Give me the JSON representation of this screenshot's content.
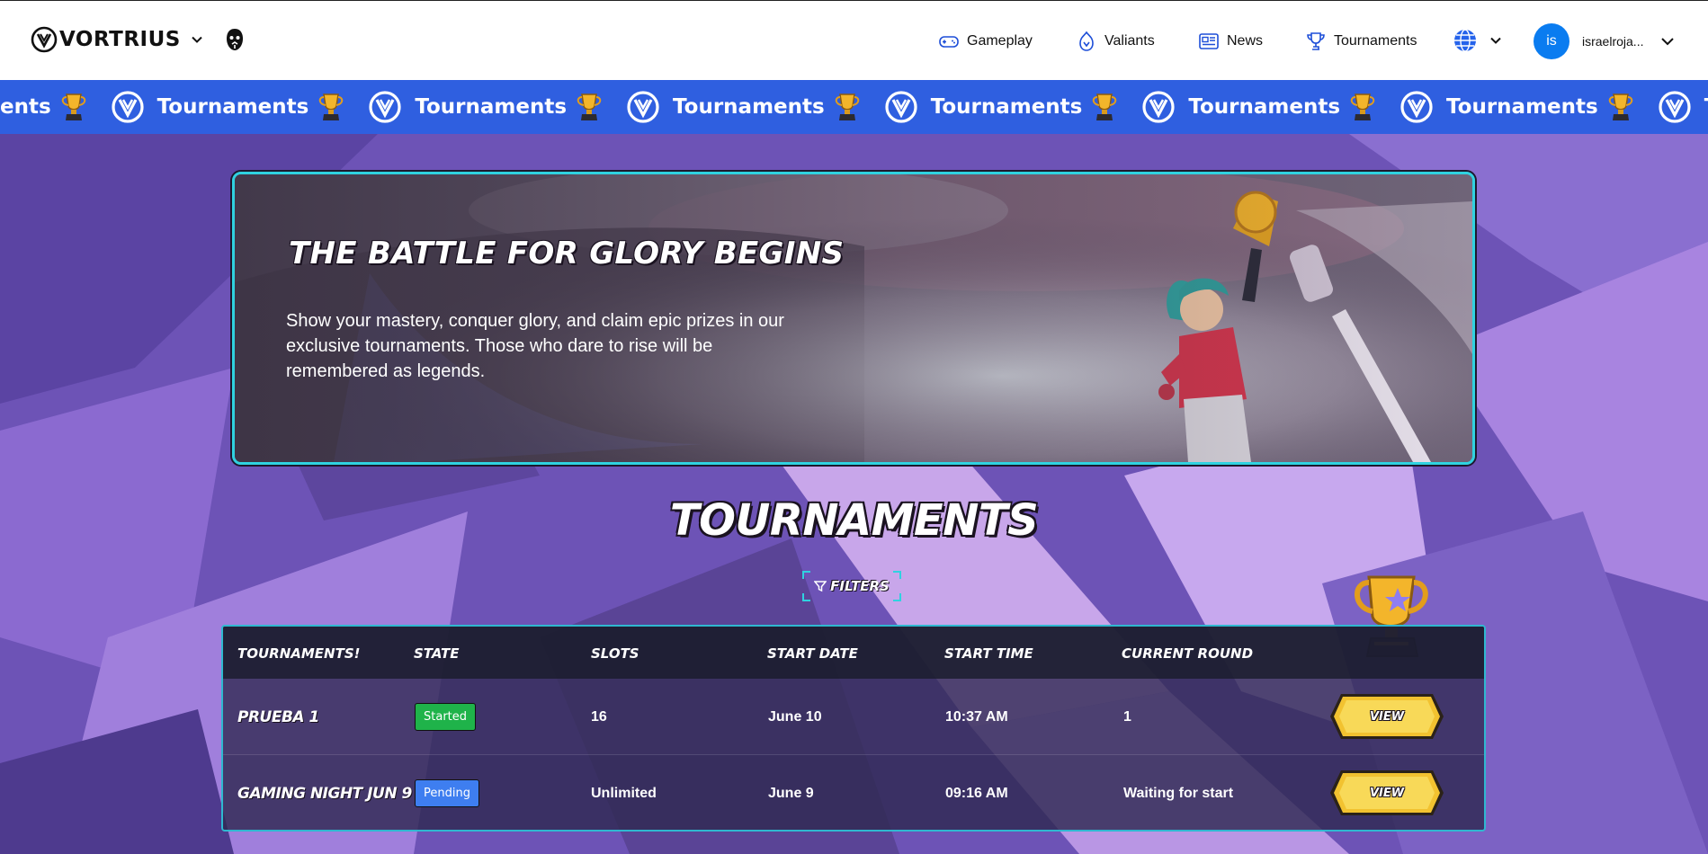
{
  "header": {
    "brand": "VORTRIUS",
    "nav": [
      {
        "label": "Gameplay",
        "icon": "gamepad-icon"
      },
      {
        "label": "Valiants",
        "icon": "valiant-flame-icon"
      },
      {
        "label": "News",
        "icon": "newspaper-icon"
      },
      {
        "label": "Tournaments",
        "icon": "trophy-icon"
      }
    ],
    "language_icon": "globe-icon",
    "user": {
      "initials": "is",
      "name": "israelroja..."
    }
  },
  "marquee": {
    "partial_start": "ents",
    "text": "Tournaments",
    "partial_end": "Tourname",
    "repeat_count": 6
  },
  "hero": {
    "title": "THE BATTLE FOR GLORY BEGINS",
    "description": "Show your mastery, conquer glory, and claim epic prizes in our exclusive tournaments. Those who dare to rise will be remembered as legends."
  },
  "section": {
    "title": "TOURNAMENTS",
    "filters_label": "FILTERS"
  },
  "table": {
    "columns": [
      "TOURNAMENTS!",
      "STATE",
      "SLOTS",
      "START DATE",
      "START TIME",
      "CURRENT ROUND"
    ],
    "rows": [
      {
        "name": "PRUEBA 1",
        "state": "Started",
        "slots": "16",
        "start_date": "June 10",
        "start_time": "10:37 AM",
        "round": "1",
        "action": "VIEW"
      },
      {
        "name": "GAMING NIGHT JUN 9",
        "state": "Pending",
        "slots": "Unlimited",
        "start_date": "June 9",
        "start_time": "09:16 AM",
        "round": "Waiting for start",
        "action": "VIEW"
      }
    ]
  },
  "colors": {
    "accent_blue": "#2f5fe0",
    "border_cyan": "#2fd2e0",
    "started_green": "#1fb34a",
    "pending_blue": "#3e7ef0",
    "button_gold": "#f2c230",
    "avatar_blue": "#0a7cf0"
  }
}
